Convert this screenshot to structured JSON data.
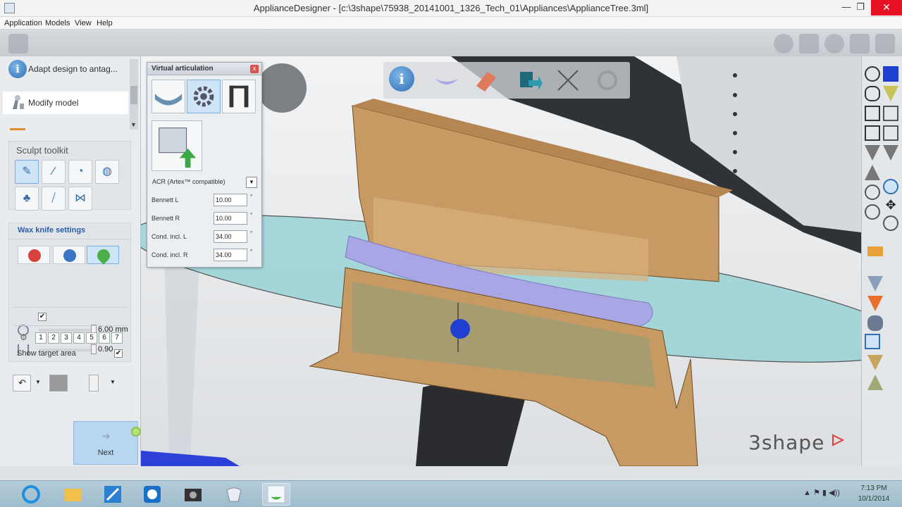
{
  "window": {
    "title": "ApplianceDesigner - [c:\\3shape\\75938_20141001_1326_Tech_01\\Appliances\\ApplianceTree.3ml]",
    "minimize_glyph": "—",
    "maximize_glyph": "❐",
    "close_glyph": "✕"
  },
  "menu": {
    "items": [
      "Application",
      "Models",
      "View",
      "Help"
    ]
  },
  "left_panel": {
    "steps": [
      {
        "label": "Adapt design to antag...",
        "icon": "info-icon"
      },
      {
        "label": "Modify model",
        "icon": "modify-model-icon"
      }
    ],
    "sculpt_toolkit": {
      "title": "Sculpt toolkit"
    },
    "wax_knife": {
      "title": "Wax knife settings",
      "radius_value": "6.00 mm",
      "strength_value": "0.90",
      "checkbox_mark": "✔",
      "numbers": [
        "1",
        "2",
        "3",
        "4",
        "5",
        "6",
        "7"
      ],
      "show_target_label": "Show target area"
    },
    "next_label": "Next"
  },
  "virtual_articulation": {
    "title": "Virtual articulation",
    "close_glyph": "x",
    "articulator": "ACR (Artex™ compatible)",
    "dropdown_glyph": "▼",
    "fields": [
      {
        "label": "Bennett L",
        "value": "10.00",
        "unit": "°"
      },
      {
        "label": "Bennett R",
        "value": "10.00",
        "unit": "°"
      },
      {
        "label": "Cond. incl. L",
        "value": "34.00",
        "unit": "°"
      },
      {
        "label": "Cond. incl. R",
        "value": "34.00",
        "unit": "°"
      }
    ]
  },
  "viewport": {
    "brand": "3shape"
  },
  "taskbar": {
    "clock_time": "7:13 PM",
    "clock_date": "10/1/2014"
  },
  "colors": {
    "model_tan": "#c79a63",
    "splint_violet": "#a9a6e6",
    "plane_cyan": "#8fd0d4",
    "accent_blue": "#2f6fb4"
  }
}
